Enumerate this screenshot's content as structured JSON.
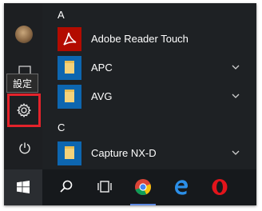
{
  "rail": {
    "tooltip": "設定"
  },
  "apps": {
    "group_a": "A",
    "group_c": "C",
    "items": [
      {
        "label": "Adobe Reader Touch",
        "icon": "adobe-reader-icon"
      },
      {
        "label": "APC",
        "icon": "folder-icon"
      },
      {
        "label": "AVG",
        "icon": "folder-icon"
      },
      {
        "label": "Capture NX-D",
        "icon": "folder-icon"
      }
    ]
  },
  "taskbar": {
    "icons": [
      "windows-start-icon",
      "search-icon",
      "task-view-icon",
      "chrome-icon",
      "edge-icon",
      "opera-icon"
    ]
  },
  "colors": {
    "start_bg": "#1e2124",
    "tile_blue": "#0d66b0",
    "adobe_red": "#b30b00",
    "highlight_red": "#e3232b"
  }
}
